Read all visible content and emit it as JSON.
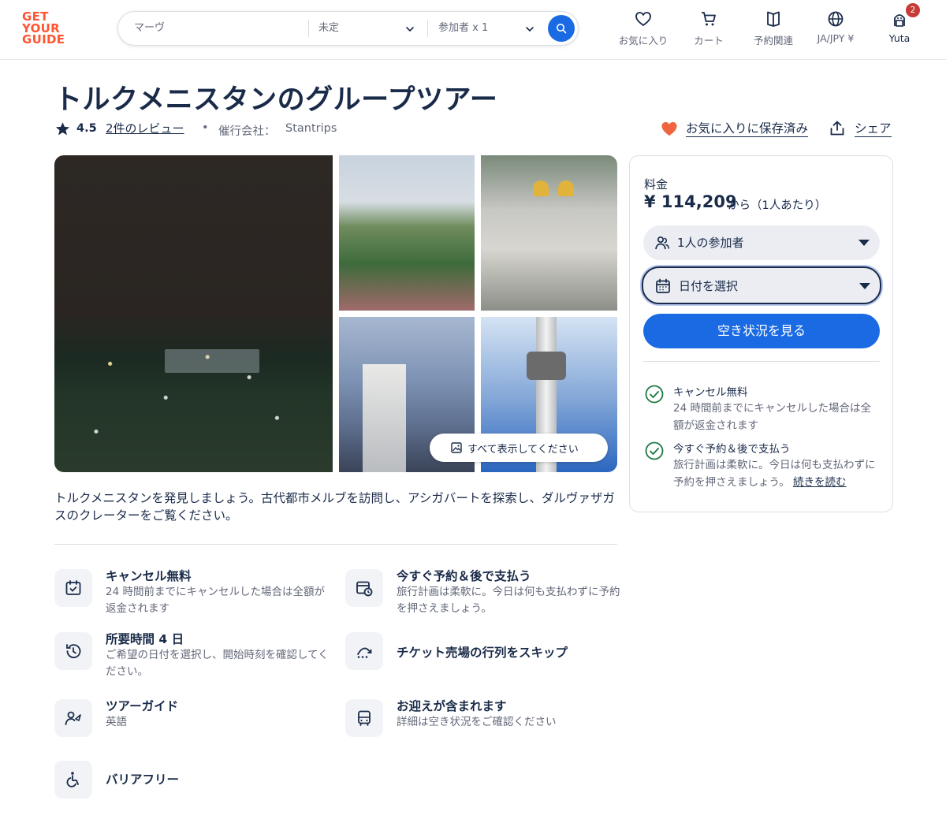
{
  "brand": {
    "logo_lines": [
      "GET",
      "YOUR",
      "GUIDE"
    ],
    "accent": "#ff5533",
    "primary": "#1a6ae4",
    "text": "#1a2b49"
  },
  "search": {
    "location_placeholder": "マーヴ",
    "date_value": "未定",
    "participants_value": "参加者 x 1"
  },
  "nav": {
    "favorites": "お気に入り",
    "cart": "カート",
    "bookings": "予約関連",
    "locale": "JA/JPY ¥",
    "user": "Yuta",
    "badge_count": "2"
  },
  "activity": {
    "title": "トルクメニスタンのグループツアー",
    "rating": "4.5",
    "reviews_link": "2件のレビュー",
    "bullet": "•",
    "provider_label": "催行会社：",
    "provider_name": "Stantrips",
    "saved_label": "お気に入りに保存済み",
    "share_label": "シェア",
    "show_all_label": "すべて表示してください",
    "description": "トルクメニスタンを発見しましょう。古代都市メルブを訪問し、アシガバートを探索し、ダルヴァザガスのクレーターをご覧ください。"
  },
  "features": [
    {
      "icon": "calendar-check-icon",
      "title": "キャンセル無料",
      "desc": "24 時間前までにキャンセルした場合は全額が返金されます"
    },
    {
      "icon": "calendar-clock-icon",
      "title": "今すぐ予約＆後で支払う",
      "desc": "旅行計画は柔軟に。今日は何も支払わずに予約を押さえましょう。"
    },
    {
      "icon": "history-clock-icon",
      "title": "所要時間 4 日",
      "desc": "ご希望の日付を選択し、開始時刻を確認してください。"
    },
    {
      "icon": "skip-line-icon",
      "title": "チケット売場の行列をスキップ",
      "desc": ""
    },
    {
      "icon": "tour-guide-icon",
      "title": "ツアーガイド",
      "desc": "英語"
    },
    {
      "icon": "bus-icon",
      "title": "お迎えが含まれます",
      "desc": "詳細は空き状況をご確認ください"
    },
    {
      "icon": "wheelchair-icon",
      "title": "バリアフリー",
      "desc": ""
    }
  ],
  "booking": {
    "price_label": "料金",
    "price": "¥ 114,209",
    "price_suffix": "から（1人あたり）",
    "participants": "1人の参加者",
    "date": "日付を選択",
    "cta": "空き状況を見る",
    "cancel_title": "キャンセル無料",
    "cancel_desc": "24 時間前までにキャンセルした場合は全額が返金されます",
    "pay_later_title": "今すぐ予約＆後で支払う",
    "pay_later_desc": "旅行計画は柔軟に。今日は何も支払わずに予約を押さえましょう。",
    "read_more": "続きを読む",
    "success_color": "#1c7a46"
  }
}
